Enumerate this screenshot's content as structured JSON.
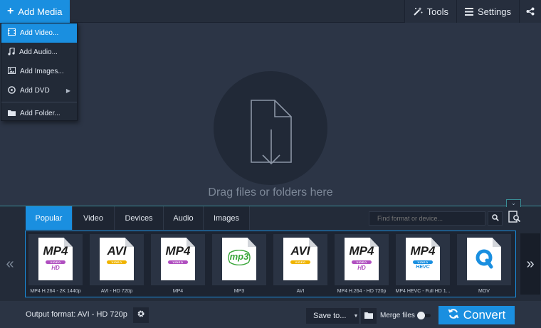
{
  "toolbar": {
    "add_media_label": "Add Media",
    "tools_label": "Tools",
    "settings_label": "Settings"
  },
  "menu": {
    "items": [
      {
        "label": "Add Video...",
        "icon": "film-icon",
        "active": true
      },
      {
        "label": "Add Audio...",
        "icon": "music-note-icon"
      },
      {
        "label": "Add Images...",
        "icon": "image-icon"
      },
      {
        "label": "Add DVD",
        "icon": "disc-icon",
        "has_submenu": true
      },
      {
        "label": "Add Folder...",
        "icon": "folder-icon"
      }
    ]
  },
  "drop_area": {
    "text": "Drag files or folders here",
    "icon": "file-download-icon"
  },
  "formats": {
    "tabs": [
      {
        "label": "Popular",
        "active": true
      },
      {
        "label": "Video"
      },
      {
        "label": "Devices"
      },
      {
        "label": "Audio"
      },
      {
        "label": "Images"
      }
    ],
    "search_placeholder": "Find format or device...",
    "items": [
      {
        "big": "MP4",
        "bar": "VIDEO",
        "sub": "HD",
        "bar_color": "#b04fc0",
        "sub_color": "#b04fc0",
        "label": "MP4 H.264 - 2K 1440p"
      },
      {
        "big": "AVI",
        "bar": "VIDEO",
        "sub": "",
        "bar_color": "#f0b400",
        "sub_color": "#f0b400",
        "label": "AVI - HD 720p"
      },
      {
        "big": "MP4",
        "bar": "VIDEO",
        "sub": "",
        "bar_color": "#b04fc0",
        "sub_color": "#b04fc0",
        "label": "MP4"
      },
      {
        "big": "mp3",
        "bar": "",
        "sub": "",
        "bar_color": "#3aa63a",
        "sub_color": "#3aa63a",
        "label": "MP3"
      },
      {
        "big": "AVI",
        "bar": "VIDEO",
        "sub": "",
        "bar_color": "#f0b400",
        "sub_color": "#f0b400",
        "label": "AVI"
      },
      {
        "big": "MP4",
        "bar": "VIDEO",
        "sub": "HD",
        "bar_color": "#b04fc0",
        "sub_color": "#b04fc0",
        "label": "MP4 H.264 - HD 720p"
      },
      {
        "big": "MP4",
        "bar": "VIDEO",
        "sub": "HEVC",
        "bar_color": "#1a8fe0",
        "sub_color": "#1a8fe0",
        "label": "MP4 HEVC - Full HD 1..."
      },
      {
        "big": "quicktime",
        "bar": "",
        "sub": "",
        "bar_color": "#1a8fe0",
        "sub_color": "#1a8fe0",
        "label": "MOV"
      }
    ]
  },
  "bottom": {
    "output_format_label": "Output format: AVI - HD 720p",
    "save_to_label": "Save to...",
    "merge_label": "Merge files",
    "merge_on": false,
    "convert_label": "Convert"
  },
  "colors": {
    "accent": "#1a8fe0",
    "background": "#2c3546"
  }
}
